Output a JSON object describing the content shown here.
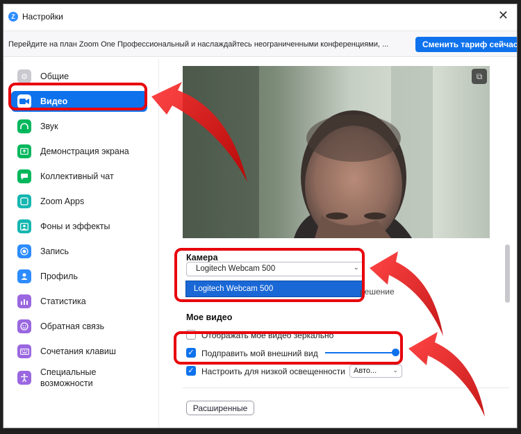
{
  "window": {
    "title": "Настройки",
    "close_label": "✕"
  },
  "banner": {
    "text": "Перейдите на план Zoom One Профессиональный и наслаждайтесь неограниченными конференциями, ...",
    "button_label": "Сменить тариф сейчас"
  },
  "sidebar": {
    "items": [
      {
        "label": "Общие",
        "icon": "gear-icon",
        "color": "#c9c9cf"
      },
      {
        "label": "Видео",
        "icon": "camera-icon",
        "color": "#0e72ed",
        "active": true
      },
      {
        "label": "Звук",
        "icon": "headphones-icon",
        "color": "#00b75c"
      },
      {
        "label": "Демонстрация экрана",
        "icon": "share-screen-icon",
        "color": "#00b75c"
      },
      {
        "label": "Коллективный чат",
        "icon": "chat-icon",
        "color": "#00b75c"
      },
      {
        "label": "Zoom Apps",
        "icon": "apps-icon",
        "color": "#15b6b0"
      },
      {
        "label": "Фоны и эффекты",
        "icon": "background-icon",
        "color": "#15b6b0"
      },
      {
        "label": "Запись",
        "icon": "record-icon",
        "color": "#2d8cff"
      },
      {
        "label": "Профиль",
        "icon": "profile-icon",
        "color": "#2d8cff"
      },
      {
        "label": "Статистика",
        "icon": "statistics-icon",
        "color": "#9a67e0"
      },
      {
        "label": "Обратная связь",
        "icon": "feedback-icon",
        "color": "#9a67e0"
      },
      {
        "label": "Сочетания клавиш",
        "icon": "keyboard-icon",
        "color": "#9a67e0"
      },
      {
        "label": "Специальные\nвозможности",
        "icon": "accessibility-icon",
        "color": "#9a67e0"
      }
    ]
  },
  "video": {
    "camera_label": "Камера",
    "camera_selected": "Logitech Webcam 500",
    "camera_option": "Logitech Webcam 500",
    "hidden_option_text": "решение",
    "my_video_label": "Мое видео",
    "mirror_label": "Отображать мое видео зеркально",
    "touch_up_label": "Подправить мой внешний вид",
    "touch_up_level": 1.0,
    "low_light_label": "Настроить для низкой освещенности",
    "low_light_value": "Авто...",
    "advanced_button": "Расширенные"
  },
  "accent_color": "#0e72ed",
  "annotation_color": "#e8000b"
}
